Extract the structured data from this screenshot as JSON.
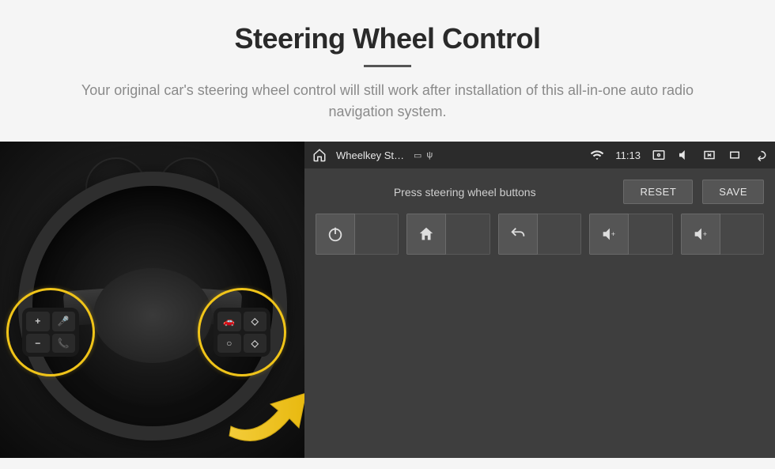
{
  "header": {
    "title": "Steering Wheel Control",
    "subtitle": "Your original car's steering wheel control will still work after installation of this all-in-one auto radio navigation system."
  },
  "wheel": {
    "left_cluster": [
      "+",
      "🎤",
      "−",
      "📞"
    ],
    "right_cluster": [
      "🚗",
      "◇",
      "○",
      "◇"
    ]
  },
  "android": {
    "status": {
      "app_name": "Wheelkey St…",
      "time": "11:13"
    },
    "hint": "Press steering wheel buttons",
    "buttons": {
      "reset": "RESET",
      "save": "SAVE"
    },
    "mappings": [
      {
        "icon": "power"
      },
      {
        "icon": "home"
      },
      {
        "icon": "back"
      },
      {
        "icon": "volume-up"
      },
      {
        "icon": "volume-up"
      }
    ]
  },
  "colors": {
    "accent": "#f0c419",
    "panel": "#3e3e3e"
  }
}
